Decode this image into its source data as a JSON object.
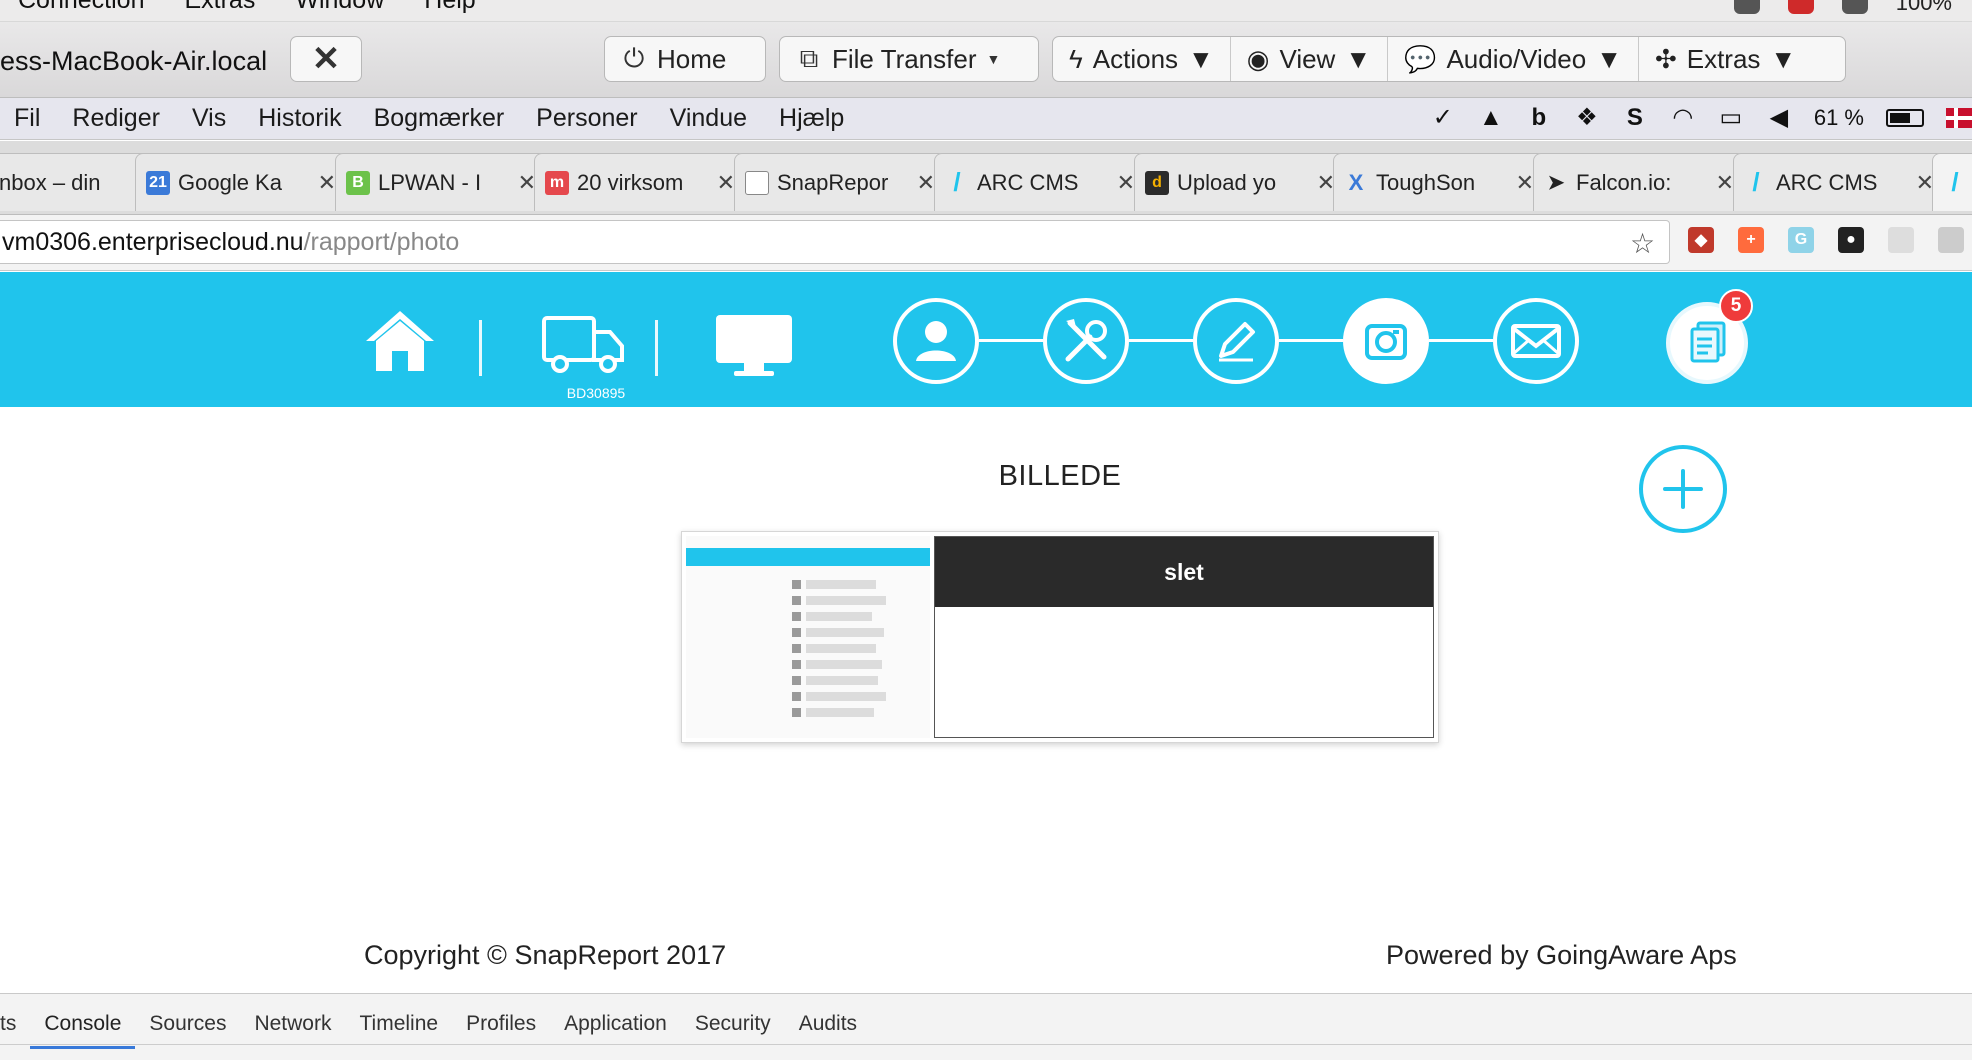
{
  "mac_menu": {
    "items": [
      "Connection",
      "Extras",
      "Window",
      "Help"
    ],
    "battery": "100%"
  },
  "remote_toolbar": {
    "host": "ess-MacBook-Air.local",
    "home": "Home",
    "file_transfer": "File Transfer",
    "actions": "Actions",
    "view": "View",
    "audio_video": "Audio/Video",
    "extras": "Extras"
  },
  "browser_menu": {
    "items": [
      "Fil",
      "Rediger",
      "Vis",
      "Historik",
      "Bogmærker",
      "Personer",
      "Vindue",
      "Hjælp"
    ],
    "battery": "61 %"
  },
  "tabs": [
    {
      "title": "nbox – din",
      "favicon": "inbox",
      "color": "#ffffff"
    },
    {
      "title": "Google Ka",
      "favicon": "21",
      "color": "#3b7ad8"
    },
    {
      "title": "LPWAN - I",
      "favicon": "B",
      "color": "#6cc24a"
    },
    {
      "title": "20 virksom",
      "favicon": "m",
      "color": "#e5484d"
    },
    {
      "title": "SnapRepor",
      "favicon": "doc",
      "color": "#ffffff"
    },
    {
      "title": "ARC CMS",
      "favicon": "arc",
      "color": "#20c4ec"
    },
    {
      "title": "Upload yo",
      "favicon": "d",
      "color": "#2b2b2b"
    },
    {
      "title": "ToughSon",
      "favicon": "X",
      "color": "#3b7ad8"
    },
    {
      "title": "Falcon.io:",
      "favicon": "falcon",
      "color": "#222222"
    },
    {
      "title": "ARC CMS",
      "favicon": "arc",
      "color": "#20c4ec"
    }
  ],
  "address": {
    "domain": "vm0306.enterprisecloud.nu",
    "path": "/rapport/photo"
  },
  "app_nav": {
    "truck_label": "BD30895",
    "badge_count": "5",
    "steps": [
      "user-icon",
      "tools-icon",
      "pencil-icon",
      "camera-icon",
      "mail-icon"
    ],
    "active_step": "camera-icon",
    "accent_color": "#20c4ec"
  },
  "main": {
    "title": "BILLEDE",
    "photos": [
      {
        "delete_label": "slet"
      }
    ]
  },
  "footer": {
    "copyright": "Copyright © SnapReport 2017",
    "powered": "Powered by GoingAware Aps"
  },
  "devtools": {
    "tabs": [
      "ts",
      "Console",
      "Sources",
      "Network",
      "Timeline",
      "Profiles",
      "Application",
      "Security",
      "Audits"
    ],
    "active": "Console"
  }
}
